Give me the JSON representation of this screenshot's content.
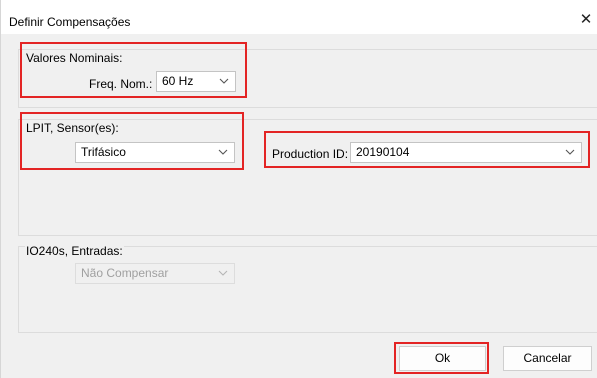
{
  "window": {
    "title": "Definir Compensações",
    "close_glyph": "✕"
  },
  "valores_nominais": {
    "legend": "Valores Nominais:",
    "freq_label": "Freq. Nom.:",
    "freq_value": "60 Hz"
  },
  "lpit": {
    "legend": "LPIT, Sensor(es):",
    "sensor_value": "Trifásico",
    "production_id_label": "Production ID:",
    "production_id_value": "20190104"
  },
  "io240s": {
    "legend": "IO240s, Entradas:",
    "value": "Não Compensar"
  },
  "buttons": {
    "ok": "Ok",
    "cancel": "Cancelar"
  },
  "icons": {
    "close": "close-icon",
    "dropdown": "chevron-down-icon"
  },
  "colors": {
    "highlight": "#e32424",
    "window_bg": "#f0f0f0"
  }
}
